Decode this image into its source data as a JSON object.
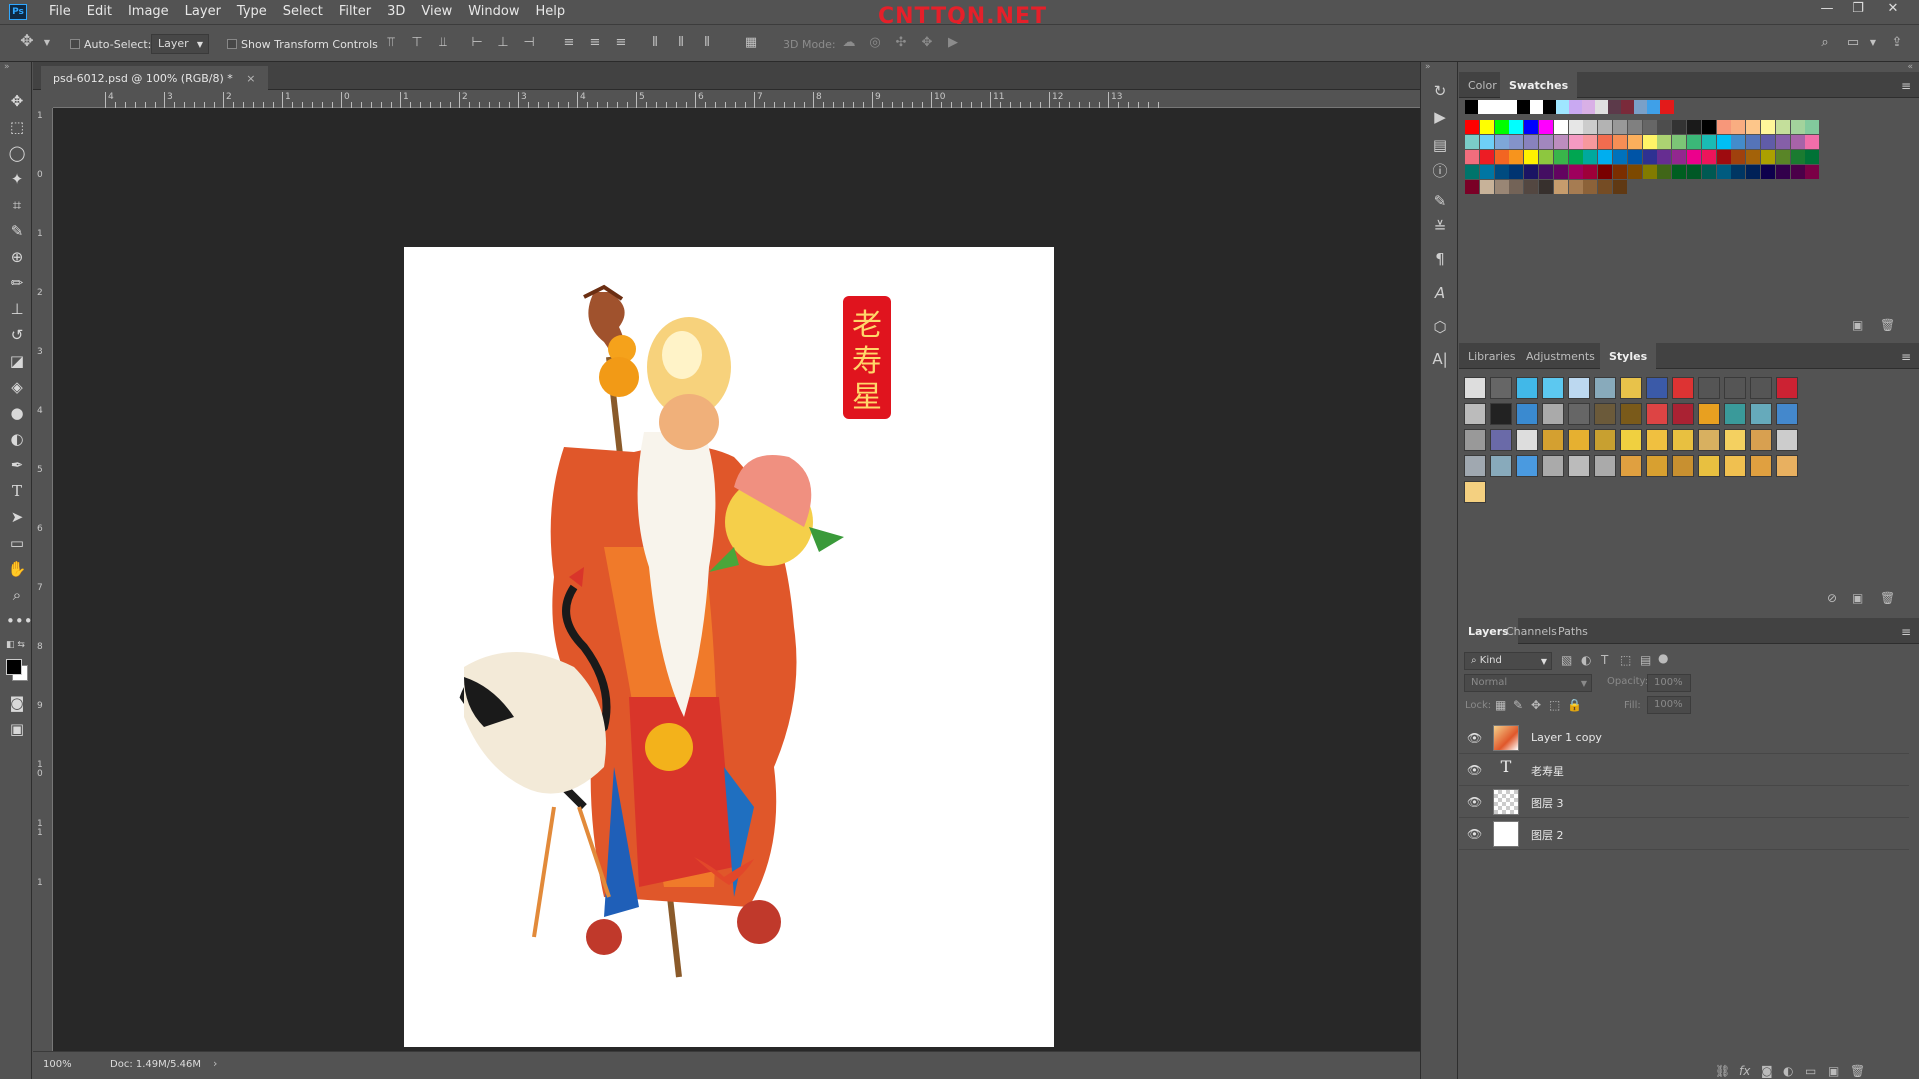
{
  "app": {
    "logo": "Ps",
    "watermark": "CNTTQN.NET"
  },
  "menu": [
    "File",
    "Edit",
    "Image",
    "Layer",
    "Type",
    "Select",
    "Filter",
    "3D",
    "View",
    "Window",
    "Help"
  ],
  "window_controls": [
    "—",
    "❐",
    "✕"
  ],
  "options": {
    "auto_select": "Auto-Select:",
    "layer_dropdown": "Layer",
    "show_transform": "Show Transform Controls",
    "mode_3d": "3D Mode:"
  },
  "document": {
    "tab_title": "psd-6012.psd @ 100% (RGB/8) *",
    "close": "×"
  },
  "ruler_top": [
    "4",
    "3",
    "2",
    "1",
    "0",
    "1",
    "2",
    "3",
    "4",
    "5",
    "6",
    "7",
    "8",
    "9",
    "10",
    "11",
    "12",
    "13"
  ],
  "ruler_left": [
    "1",
    "0",
    "1",
    "2",
    "3",
    "4",
    "5",
    "6",
    "7",
    "8",
    "9",
    "1\n0",
    "1\n1",
    "1"
  ],
  "canvas": {
    "stamp_text": [
      "老",
      "寿",
      "星"
    ]
  },
  "status": {
    "zoom": "100%",
    "doc": "Doc: 1.49M/5.46M"
  },
  "panels": {
    "color_tabs": [
      "Color",
      "Swatches"
    ],
    "style_tabs": [
      "Libraries",
      "Adjustments",
      "Styles"
    ],
    "layer_tabs": [
      "Layers",
      "Channels",
      "Paths"
    ],
    "filter_kind": "Kind",
    "blend_mode": "Normal",
    "opacity_label": "Opacity:",
    "opacity_value": "100%",
    "lock_label": "Lock:",
    "fill_label": "Fill:",
    "fill_value": "100%"
  },
  "layers": [
    {
      "name": "Layer 1 copy",
      "kind": "image"
    },
    {
      "name": "老寿星",
      "kind": "text"
    },
    {
      "name": "图层 3",
      "kind": "transparent"
    },
    {
      "name": "图层 2",
      "kind": "white"
    }
  ],
  "colors": {
    "accent": "#31a8ff",
    "stamp_red": "#e0141e",
    "stamp_text": "#ffd76a"
  }
}
